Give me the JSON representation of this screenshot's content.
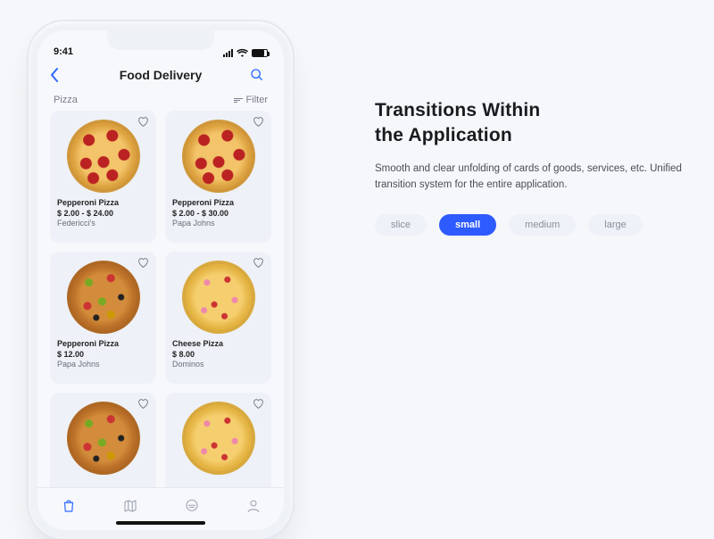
{
  "status": {
    "time": "9:41"
  },
  "header": {
    "title": "Food Delivery"
  },
  "filter_row": {
    "category": "Pizza",
    "filter_label": "Filter"
  },
  "products": [
    {
      "name": "Pepperoni Pizza",
      "price": "$ 2.00 - $ 24.00",
      "vendor": "Federicci's",
      "variant": "pep"
    },
    {
      "name": "Pepperoni Pizza",
      "price": "$ 2.00 - $ 30.00",
      "vendor": "Papa Johns",
      "variant": "pep"
    },
    {
      "name": "Pepperoni Pizza",
      "price": "$ 12.00",
      "vendor": "Papa Johns",
      "variant": "sup"
    },
    {
      "name": "Cheese Pizza",
      "price": "$ 8.00",
      "vendor": "Dominos",
      "variant": "chee"
    },
    {
      "name": "",
      "price": "",
      "vendor": "",
      "variant": "sup"
    },
    {
      "name": "",
      "price": "",
      "vendor": "",
      "variant": "chee"
    }
  ],
  "panel": {
    "heading_line1": "Transitions Within",
    "heading_line2": "the Application",
    "body": "Smooth and clear unfolding of cards of goods, services, etc. Unified transition system for the entire application."
  },
  "sizes": {
    "options": [
      "slice",
      "small",
      "medium",
      "large"
    ],
    "selected_index": 1
  }
}
